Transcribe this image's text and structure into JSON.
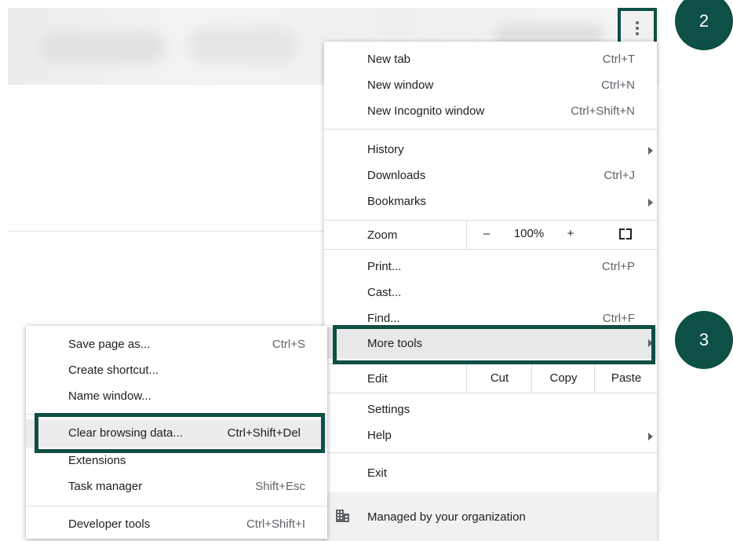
{
  "steps": {
    "two": "2",
    "three": "3"
  },
  "menu": {
    "new_tab": {
      "label": "New tab",
      "shortcut": "Ctrl+T"
    },
    "new_window": {
      "label": "New window",
      "shortcut": "Ctrl+N"
    },
    "new_incognito": {
      "label": "New Incognito window",
      "shortcut": "Ctrl+Shift+N"
    },
    "history": {
      "label": "History"
    },
    "downloads": {
      "label": "Downloads",
      "shortcut": "Ctrl+J"
    },
    "bookmarks": {
      "label": "Bookmarks"
    },
    "zoom": {
      "label": "Zoom",
      "minus": "–",
      "level": "100%",
      "plus": "+"
    },
    "print": {
      "label": "Print...",
      "shortcut": "Ctrl+P"
    },
    "cast": {
      "label": "Cast..."
    },
    "find": {
      "label": "Find...",
      "shortcut": "Ctrl+F"
    },
    "more_tools": {
      "label": "More tools"
    },
    "edit": {
      "label": "Edit",
      "cut": "Cut",
      "copy": "Copy",
      "paste": "Paste"
    },
    "settings": {
      "label": "Settings"
    },
    "help": {
      "label": "Help"
    },
    "exit": {
      "label": "Exit"
    },
    "managed": {
      "label": "Managed by your organization"
    }
  },
  "submenu": {
    "save_page": {
      "label": "Save page as...",
      "shortcut": "Ctrl+S"
    },
    "create_shortcut": {
      "label": "Create shortcut..."
    },
    "name_window": {
      "label": "Name window..."
    },
    "clear_browsing": {
      "label": "Clear browsing data...",
      "shortcut": "Ctrl+Shift+Del"
    },
    "extensions": {
      "label": "Extensions"
    },
    "task_manager": {
      "label": "Task manager",
      "shortcut": "Shift+Esc"
    },
    "developer_tools": {
      "label": "Developer tools",
      "shortcut": "Ctrl+Shift+I"
    }
  },
  "colors": {
    "callout": "#0e4f46",
    "highlight": "#e8e8e8"
  },
  "icons": {
    "menu": "kebab-icon",
    "managed": "building-icon",
    "fullscreen": "fullscreen-icon",
    "submenu": "chevron-right-icon"
  }
}
